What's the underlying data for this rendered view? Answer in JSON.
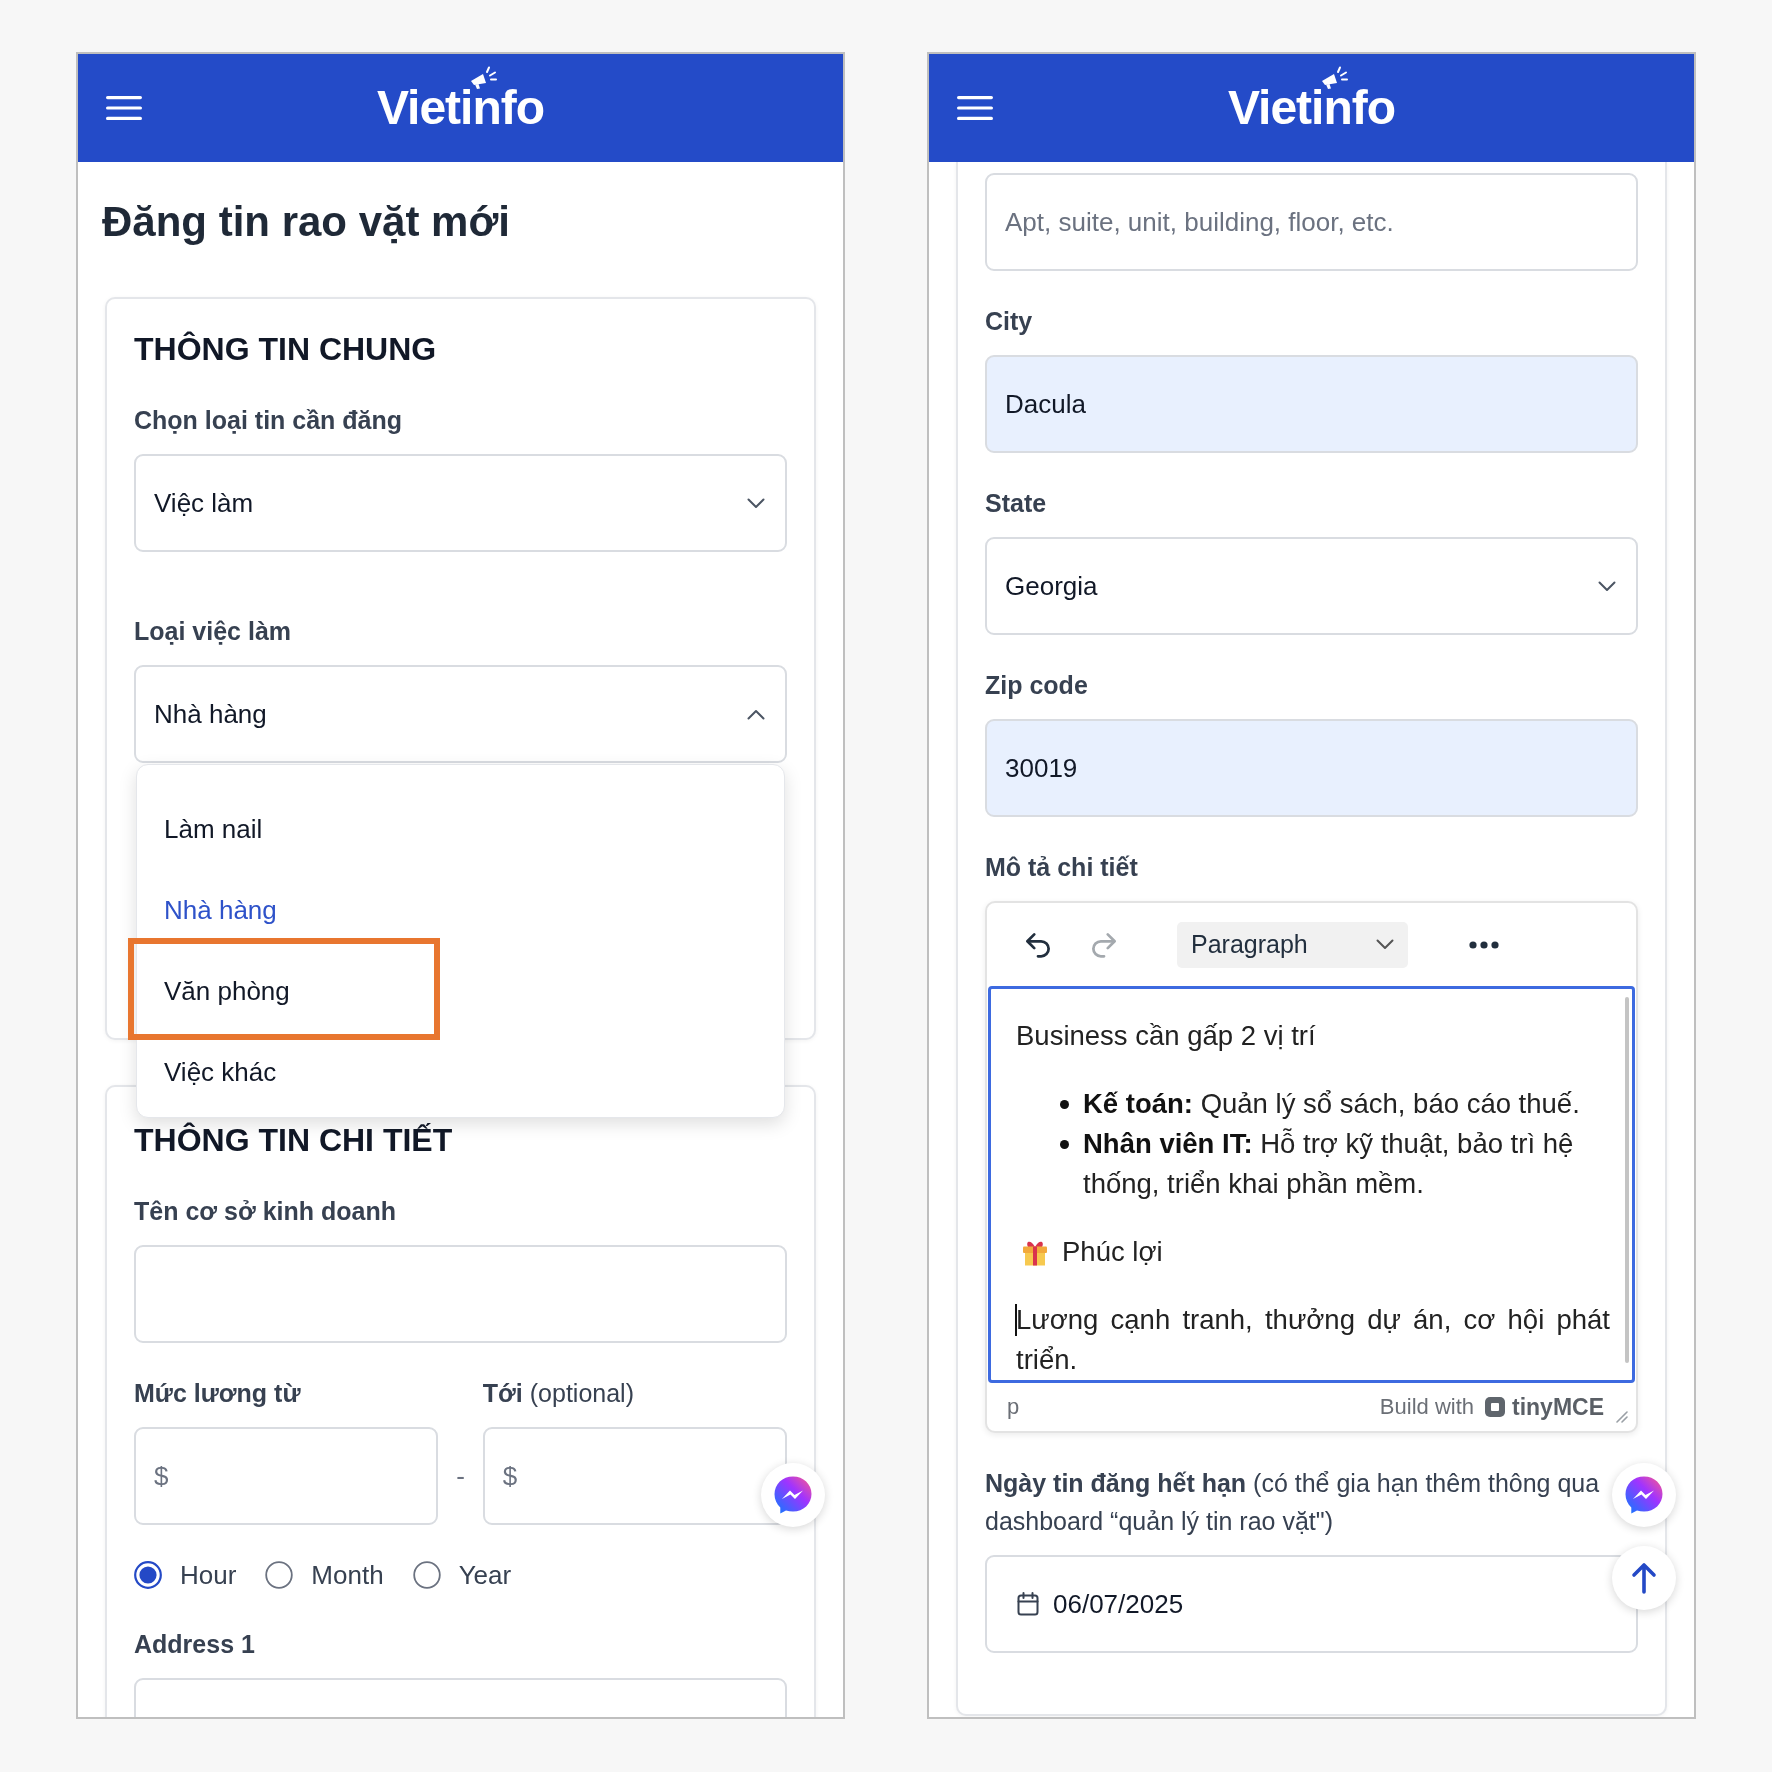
{
  "left_phone": {
    "header": {
      "logo": "Vietinfo"
    },
    "page_title": "Đăng tin rao vặt mới",
    "cards": [
      {
        "title": "THÔNG TIN CHUNG",
        "fields": [
          {
            "kind": "select",
            "label": "Chọn loại tin cần đăng",
            "value": "Việc làm",
            "expanded": false
          },
          {
            "kind": "select",
            "label": "Loại việc làm",
            "value": "Nhà hàng",
            "expanded": true,
            "options": [
              {
                "label": "Làm nail",
                "selected": false,
                "highlighted": false
              },
              {
                "label": "Nhà hàng",
                "selected": true,
                "highlighted": false
              },
              {
                "label": "Văn phòng",
                "selected": false,
                "highlighted": true
              },
              {
                "label": "Việc khác",
                "selected": false,
                "highlighted": false
              }
            ]
          }
        ]
      },
      {
        "title": "THÔNG TIN CHI TIẾT",
        "fields": [
          {
            "kind": "input",
            "label": "Tên cơ sở kinh doanh",
            "autofilled": false
          },
          {
            "kind": "salary_range",
            "from": {
              "label": "Mức lương từ",
              "prefix": "$"
            },
            "separator": "-",
            "to": {
              "label": "**Tới** (optional)",
              "prefix": "$"
            }
          },
          {
            "kind": "radio_group",
            "options": [
              {
                "label": "Hour",
                "selected": true
              },
              {
                "label": "Month",
                "selected": false
              },
              {
                "label": "Year",
                "selected": false
              }
            ]
          },
          {
            "kind": "input",
            "label": "Address 1",
            "autofilled": false
          }
        ]
      }
    ],
    "floating_buttons": [
      {
        "kind": "messenger"
      }
    ]
  },
  "right_phone": {
    "header": {
      "logo": "Vietinfo"
    },
    "fields": [
      {
        "kind": "input",
        "placeholder": "Apt, suite, unit, building, floor, etc.",
        "autofilled": false
      },
      {
        "kind": "input",
        "label": "City",
        "value": "Dacula",
        "autofilled": true
      },
      {
        "kind": "select",
        "label": "State",
        "value": "Georgia",
        "expanded": false
      },
      {
        "kind": "input",
        "label": "Zip code",
        "value": "30019",
        "autofilled": true
      },
      {
        "kind": "editor",
        "label": "Mô tả chi tiết",
        "focused": true,
        "toolbar": {
          "undo_disabled": false,
          "redo_disabled": true,
          "block_format": "Paragraph"
        },
        "content": [
          {
            "kind": "paragraph",
            "text": "Business cần gấp 2 vị trí",
            "caret": false
          },
          {
            "kind": "bullet_list",
            "items": [
              "**Kế toán:** Quản lý sổ sách, báo cáo thuế.",
              "**Nhân viên IT:** Hỗ trợ kỹ thuật, bảo trì hệ thống, triển khai phần mềm."
            ]
          },
          {
            "kind": "icon_paragraph",
            "text": "Phúc lợi"
          },
          {
            "kind": "paragraph",
            "text": "Lương cạnh tranh, thưởng dự án, cơ hội phát triển.",
            "caret": true
          }
        ],
        "element_path": "p",
        "branding": "Build with",
        "brand": "tinyMCE"
      },
      {
        "kind": "date",
        "label": "**Ngày tin đăng hết hạn** (có thể gia hạn thêm thông qua dashboard “quản lý tin rao vặt\")",
        "value": "06/07/2025"
      }
    ],
    "floating_buttons": [
      {
        "kind": "messenger"
      },
      {
        "kind": "scroll_top"
      }
    ]
  }
}
